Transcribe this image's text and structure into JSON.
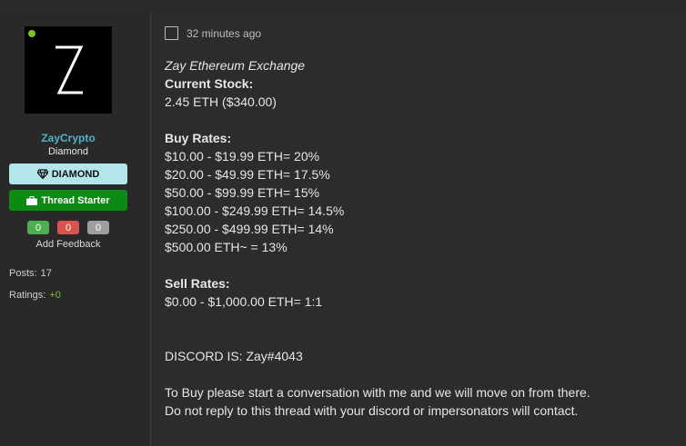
{
  "user": {
    "name": "ZayCrypto",
    "title": "Diamond",
    "avatar_letter": "Z",
    "online": true,
    "online_color": "#7ac41f",
    "banners": [
      {
        "label": "DIAMOND",
        "icon": "diamond-icon",
        "color": "#b3e6ea"
      },
      {
        "label": "Thread Starter",
        "icon": "briefcase-icon",
        "color": "#0c8a14"
      }
    ],
    "feedback": {
      "positive": "0",
      "negative": "0",
      "neutral": "0",
      "add_label": "Add Feedback"
    },
    "stats": {
      "posts_label": "Posts:",
      "posts_value": "17",
      "ratings_label": "Ratings:",
      "ratings_value": "+0"
    }
  },
  "post": {
    "timestamp": "32 minutes ago",
    "title": "Zay Ethereum Exchange",
    "stock_heading": "Current Stock:",
    "stock_value": "2.45 ETH ($340.00)",
    "buy_heading": "Buy Rates:",
    "buy_rates": [
      "$10.00 - $19.99 ETH= 20%",
      "$20.00 - $49.99 ETH= 17.5%",
      "$50.00 - $99.99 ETH= 15%",
      "$100.00 - $249.99 ETH= 14.5%",
      "$250.00 - $499.99 ETH= 14%",
      "$500.00 ETH~ = 13%"
    ],
    "sell_heading": "Sell Rates:",
    "sell_rates": [
      "$0.00 - $1,000.00 ETH= 1:1"
    ],
    "discord": "DISCORD IS: Zay#4043",
    "instructions": [
      "To Buy please start a conversation with me and we will move on from there.",
      "Do not reply to this thread with your discord or impersonators will contact."
    ]
  }
}
